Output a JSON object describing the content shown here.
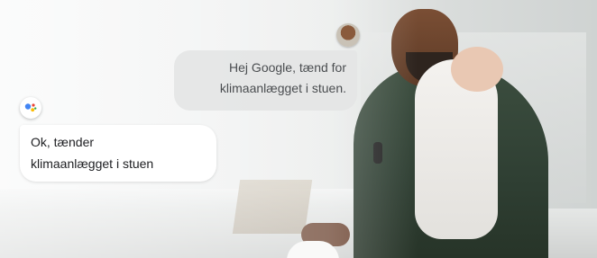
{
  "user_message": {
    "line1": "Hej Google, tænd for",
    "line2": "klimaanlægget i stuen."
  },
  "assistant_message": {
    "line1": "Ok, tænder",
    "line2": "klimaanlægget i stuen"
  },
  "icons": {
    "user_avatar": "user-avatar",
    "assistant": "google-assistant-icon"
  },
  "colors": {
    "assistant_blue": "#4285F4",
    "assistant_red": "#EA4335",
    "assistant_yellow": "#FBBC05",
    "assistant_green": "#34A853"
  }
}
